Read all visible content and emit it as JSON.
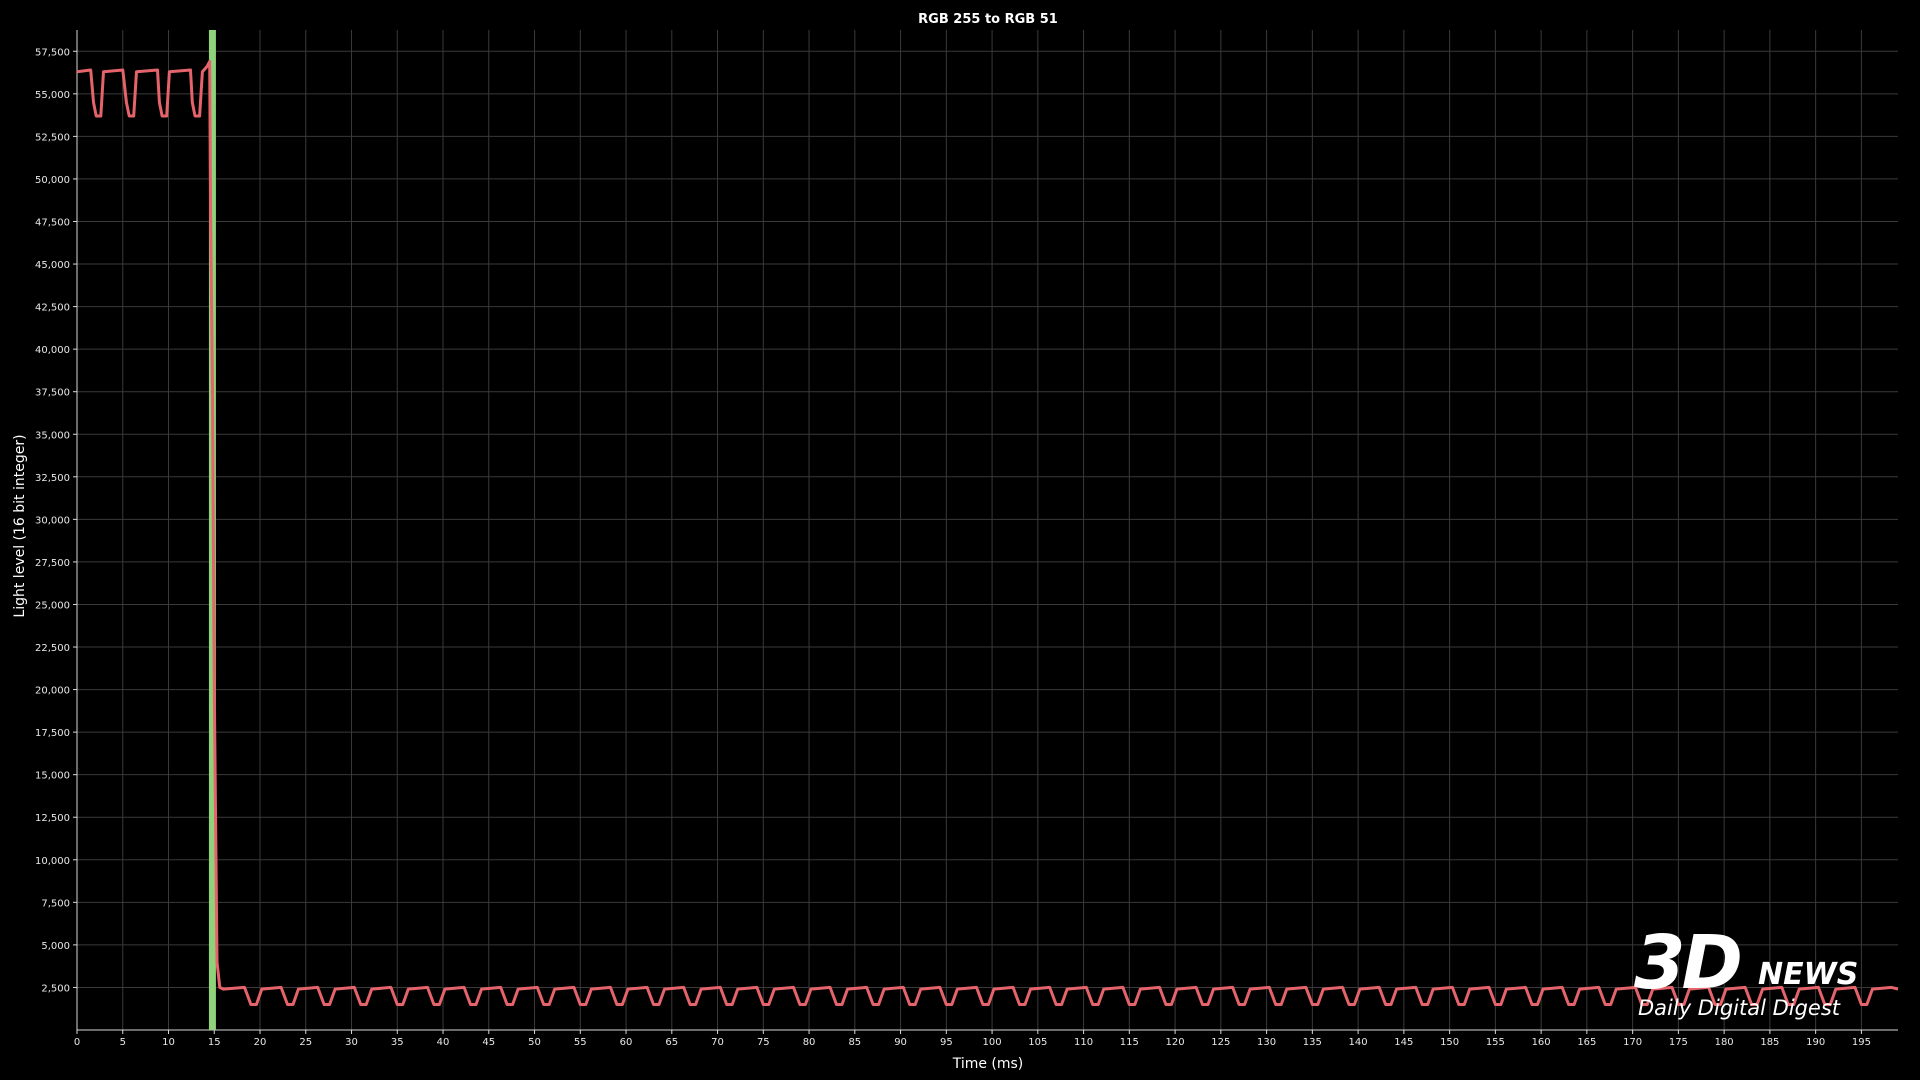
{
  "chart_data": {
    "type": "line",
    "title": "RGB 255 to RGB 51",
    "xlabel": "Time (ms)",
    "ylabel": "Light level (16 bit integer)",
    "xlim": [
      0,
      199
    ],
    "ylim": [
      0,
      58750
    ],
    "x_ticks": [
      0,
      5,
      10,
      15,
      20,
      25,
      30,
      35,
      40,
      45,
      50,
      55,
      60,
      65,
      70,
      75,
      80,
      85,
      90,
      95,
      100,
      105,
      110,
      115,
      120,
      125,
      130,
      135,
      140,
      145,
      150,
      155,
      160,
      165,
      170,
      175,
      180,
      185,
      190,
      195
    ],
    "y_ticks": [
      2500,
      5000,
      7500,
      10000,
      12500,
      15000,
      17500,
      20000,
      22500,
      25000,
      27500,
      30000,
      32500,
      35000,
      37500,
      40000,
      42500,
      45000,
      47500,
      50000,
      52500,
      55000,
      57500
    ],
    "grid": true,
    "marker": {
      "x": 14.8,
      "label": "",
      "color": "#8fd27a"
    },
    "series": [
      {
        "color": "#e5636a",
        "points": [
          [
            0,
            56300
          ],
          [
            1.5,
            56400
          ],
          [
            1.8,
            54500
          ],
          [
            2.1,
            53700
          ],
          [
            2.6,
            53700
          ],
          [
            2.9,
            56300
          ],
          [
            5.0,
            56400
          ],
          [
            5.4,
            54500
          ],
          [
            5.7,
            53700
          ],
          [
            6.2,
            53700
          ],
          [
            6.5,
            56300
          ],
          [
            8.8,
            56400
          ],
          [
            9.0,
            54500
          ],
          [
            9.3,
            53700
          ],
          [
            9.8,
            53700
          ],
          [
            10.1,
            56300
          ],
          [
            12.4,
            56400
          ],
          [
            12.6,
            54500
          ],
          [
            12.9,
            53700
          ],
          [
            13.4,
            53700
          ],
          [
            13.7,
            56300
          ],
          [
            14.2,
            56600
          ],
          [
            14.5,
            56900
          ],
          [
            14.6,
            48000
          ],
          [
            14.8,
            38000
          ],
          [
            15.0,
            20000
          ],
          [
            15.3,
            4000
          ],
          [
            15.6,
            2500
          ],
          [
            16,
            2400
          ],
          [
            18.3,
            2500
          ],
          [
            19.0,
            1500
          ],
          [
            19.6,
            1500
          ],
          [
            20.2,
            2400
          ],
          [
            22.3,
            2500
          ],
          [
            23.0,
            1500
          ],
          [
            23.6,
            1500
          ],
          [
            24.2,
            2400
          ],
          [
            26.3,
            2500
          ],
          [
            27.0,
            1500
          ],
          [
            27.6,
            1500
          ],
          [
            28.2,
            2400
          ],
          [
            30.3,
            2500
          ],
          [
            31.0,
            1500
          ],
          [
            31.6,
            1500
          ],
          [
            32.2,
            2400
          ],
          [
            34.3,
            2500
          ],
          [
            35.0,
            1500
          ],
          [
            35.6,
            1500
          ],
          [
            36.2,
            2400
          ],
          [
            38.3,
            2500
          ],
          [
            39.0,
            1500
          ],
          [
            39.6,
            1500
          ],
          [
            40.2,
            2400
          ],
          [
            42.3,
            2500
          ],
          [
            43.0,
            1500
          ],
          [
            43.6,
            1500
          ],
          [
            44.2,
            2400
          ],
          [
            46.3,
            2500
          ],
          [
            47.0,
            1500
          ],
          [
            47.6,
            1500
          ],
          [
            48.2,
            2400
          ],
          [
            50.3,
            2500
          ],
          [
            51.0,
            1500
          ],
          [
            51.6,
            1500
          ],
          [
            52.2,
            2400
          ],
          [
            54.3,
            2500
          ],
          [
            55.0,
            1500
          ],
          [
            55.6,
            1500
          ],
          [
            56.2,
            2400
          ],
          [
            58.3,
            2500
          ],
          [
            59.0,
            1500
          ],
          [
            59.6,
            1500
          ],
          [
            60.2,
            2400
          ],
          [
            62.3,
            2500
          ],
          [
            63.0,
            1500
          ],
          [
            63.6,
            1500
          ],
          [
            64.2,
            2400
          ],
          [
            66.3,
            2500
          ],
          [
            67.0,
            1500
          ],
          [
            67.6,
            1500
          ],
          [
            68.2,
            2400
          ],
          [
            70.3,
            2500
          ],
          [
            71.0,
            1500
          ],
          [
            71.6,
            1500
          ],
          [
            72.2,
            2400
          ],
          [
            74.3,
            2500
          ],
          [
            75.0,
            1500
          ],
          [
            75.6,
            1500
          ],
          [
            76.2,
            2400
          ],
          [
            78.3,
            2500
          ],
          [
            79.0,
            1500
          ],
          [
            79.6,
            1500
          ],
          [
            80.2,
            2400
          ],
          [
            82.3,
            2500
          ],
          [
            83.0,
            1500
          ],
          [
            83.6,
            1500
          ],
          [
            84.2,
            2400
          ],
          [
            86.3,
            2500
          ],
          [
            87.0,
            1500
          ],
          [
            87.6,
            1500
          ],
          [
            88.2,
            2400
          ],
          [
            90.3,
            2500
          ],
          [
            91.0,
            1500
          ],
          [
            91.6,
            1500
          ],
          [
            92.2,
            2400
          ],
          [
            94.3,
            2500
          ],
          [
            95.0,
            1500
          ],
          [
            95.6,
            1500
          ],
          [
            96.2,
            2400
          ],
          [
            98.3,
            2500
          ],
          [
            99.0,
            1500
          ],
          [
            99.6,
            1500
          ],
          [
            100.2,
            2400
          ],
          [
            102.3,
            2500
          ],
          [
            103.0,
            1500
          ],
          [
            103.6,
            1500
          ],
          [
            104.2,
            2400
          ],
          [
            106.3,
            2500
          ],
          [
            107.0,
            1500
          ],
          [
            107.6,
            1500
          ],
          [
            108.2,
            2400
          ],
          [
            110.3,
            2500
          ],
          [
            111.0,
            1500
          ],
          [
            111.6,
            1500
          ],
          [
            112.2,
            2400
          ],
          [
            114.3,
            2500
          ],
          [
            115.0,
            1500
          ],
          [
            115.6,
            1500
          ],
          [
            116.2,
            2400
          ],
          [
            118.3,
            2500
          ],
          [
            119.0,
            1500
          ],
          [
            119.6,
            1500
          ],
          [
            120.2,
            2400
          ],
          [
            122.3,
            2500
          ],
          [
            123.0,
            1500
          ],
          [
            123.6,
            1500
          ],
          [
            124.2,
            2400
          ],
          [
            126.3,
            2500
          ],
          [
            127.0,
            1500
          ],
          [
            127.6,
            1500
          ],
          [
            128.2,
            2400
          ],
          [
            130.3,
            2500
          ],
          [
            131.0,
            1500
          ],
          [
            131.6,
            1500
          ],
          [
            132.2,
            2400
          ],
          [
            134.3,
            2500
          ],
          [
            135.0,
            1500
          ],
          [
            135.6,
            1500
          ],
          [
            136.2,
            2400
          ],
          [
            138.3,
            2500
          ],
          [
            139.0,
            1500
          ],
          [
            139.6,
            1500
          ],
          [
            140.2,
            2400
          ],
          [
            142.3,
            2500
          ],
          [
            143.0,
            1500
          ],
          [
            143.6,
            1500
          ],
          [
            144.2,
            2400
          ],
          [
            146.3,
            2500
          ],
          [
            147.0,
            1500
          ],
          [
            147.6,
            1500
          ],
          [
            148.2,
            2400
          ],
          [
            150.3,
            2500
          ],
          [
            151.0,
            1500
          ],
          [
            151.6,
            1500
          ],
          [
            152.2,
            2400
          ],
          [
            154.3,
            2500
          ],
          [
            155.0,
            1500
          ],
          [
            155.6,
            1500
          ],
          [
            156.2,
            2400
          ],
          [
            158.3,
            2500
          ],
          [
            159.0,
            1500
          ],
          [
            159.6,
            1500
          ],
          [
            160.2,
            2400
          ],
          [
            162.3,
            2500
          ],
          [
            163.0,
            1500
          ],
          [
            163.6,
            1500
          ],
          [
            164.2,
            2400
          ],
          [
            166.3,
            2500
          ],
          [
            167.0,
            1500
          ],
          [
            167.6,
            1500
          ],
          [
            168.2,
            2400
          ],
          [
            170.3,
            2500
          ],
          [
            171.0,
            1500
          ],
          [
            171.6,
            1500
          ],
          [
            172.2,
            2400
          ],
          [
            174.3,
            2500
          ],
          [
            175.0,
            1500
          ],
          [
            175.6,
            1500
          ],
          [
            176.2,
            2400
          ],
          [
            178.3,
            2500
          ],
          [
            179.0,
            1500
          ],
          [
            179.6,
            1500
          ],
          [
            180.2,
            2400
          ],
          [
            182.3,
            2500
          ],
          [
            183.0,
            1500
          ],
          [
            183.6,
            1500
          ],
          [
            184.2,
            2400
          ],
          [
            186.3,
            2500
          ],
          [
            187.0,
            1500
          ],
          [
            187.6,
            1500
          ],
          [
            188.2,
            2400
          ],
          [
            190.3,
            2500
          ],
          [
            191.0,
            1500
          ],
          [
            191.6,
            1500
          ],
          [
            192.2,
            2400
          ],
          [
            194.3,
            2500
          ],
          [
            195.0,
            1500
          ],
          [
            195.6,
            1500
          ],
          [
            196.2,
            2400
          ],
          [
            198.3,
            2500
          ],
          [
            199,
            2400
          ]
        ]
      }
    ]
  },
  "watermark": {
    "logo_3d": "3D",
    "logo_news": "NEWS",
    "tagline": "Daily Digital Digest"
  }
}
